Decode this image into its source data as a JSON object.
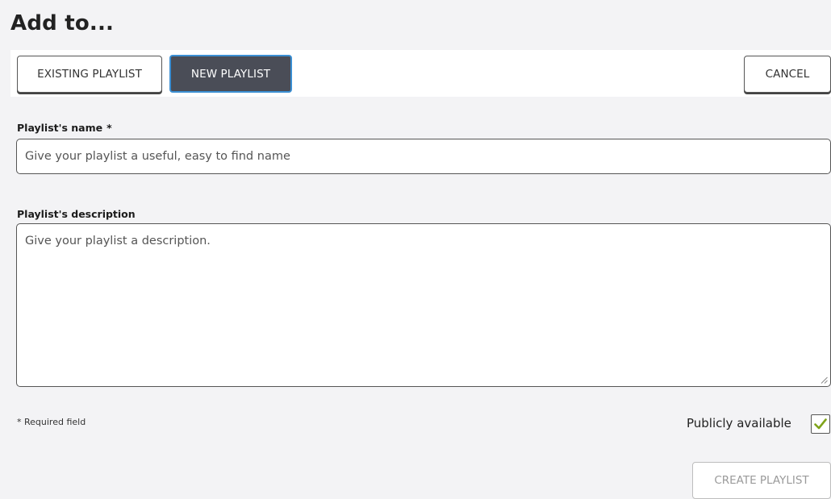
{
  "dialog": {
    "title": "Add to..."
  },
  "tabs": {
    "existing_label": "EXISTING PLAYLIST",
    "new_label": "NEW PLAYLIST",
    "cancel_label": "CANCEL"
  },
  "form": {
    "name_label": "Playlist's name",
    "name_required_marker": "*",
    "name_placeholder": "Give your playlist a useful, easy to find name",
    "description_label": "Playlist's description",
    "description_placeholder": "Give your playlist a description.",
    "required_note": "* Required field",
    "public_label": "Publicly available",
    "public_checked": true,
    "create_label": "CREATE PLAYLIST"
  },
  "colors": {
    "background": "#f3f3f5",
    "active_tab_bg": "#4a4d57",
    "active_tab_border": "#3b8fd3",
    "checkmark": "#7fa31a",
    "disabled_text": "#9a9a9a"
  },
  "icons": {
    "checkbox": "checkmark-icon",
    "resize": "resize-grip-icon"
  }
}
